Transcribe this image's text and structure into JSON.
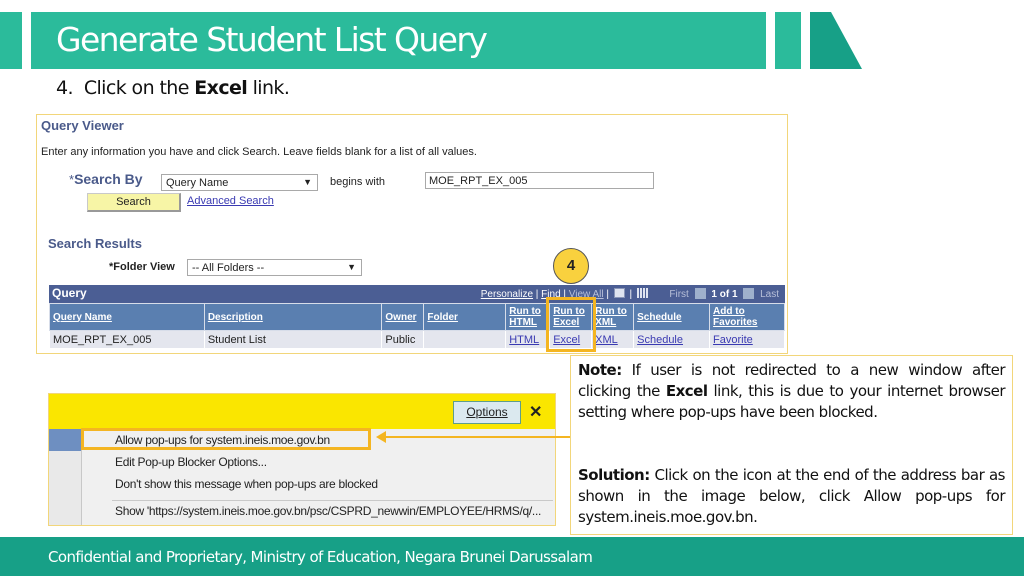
{
  "slide": {
    "title": "Generate Student List Query",
    "step_number": "4.",
    "step_prefix": "Click on the ",
    "step_bold": "Excel",
    "step_suffix": " link.",
    "badge": "4",
    "accent_color": "#2bbb9b",
    "highlight_color": "#f4b521"
  },
  "query_viewer": {
    "title": "Query Viewer",
    "instructions": "Enter any information you have and click Search. Leave fields blank for a list of all values.",
    "search_by_required": "*",
    "search_by_label": "Search By",
    "search_by_value": "Query Name",
    "begins_with_label": "begins with",
    "search_value": "MOE_RPT_EX_005",
    "search_button": "Search",
    "advanced_search": "Advanced Search",
    "results_title": "Search Results",
    "folder_view_label": "*Folder View",
    "folder_view_value": "-- All Folders --",
    "grid": {
      "title": "Query",
      "personalize": "Personalize",
      "find": "Find",
      "view_all": "View All",
      "first": "First",
      "page_info": "1 of 1",
      "last": "Last",
      "columns": [
        "Query Name",
        "Description",
        "Owner",
        "Folder",
        "Run to HTML",
        "Run to Excel",
        "Run to XML",
        "Schedule",
        "Add to Favorites"
      ],
      "rows": [
        {
          "query_name": "MOE_RPT_EX_005",
          "description": "Student List",
          "owner": "Public",
          "folder": "",
          "html": "HTML",
          "excel": "Excel",
          "xml": "XML",
          "schedule": "Schedule",
          "favorite": "Favorite"
        }
      ]
    }
  },
  "popup_blocker": {
    "options_button": "Options",
    "close": "✕",
    "menu": [
      "Allow pop-ups for system.ineis.moe.gov.bn",
      "Edit Pop-up Blocker Options...",
      "Don't show this message when pop-ups are blocked",
      "Show 'https://system.ineis.moe.gov.bn/psc/CSPRD_newwin/EMPLOYEE/HRMS/q/..."
    ]
  },
  "note": {
    "note_label": "Note:",
    "note_text_1": " If user is not redirected to a new window after clicking the ",
    "note_bold": "Excel",
    "note_text_2": " link, this is due to your internet browser setting where pop-ups have been blocked.",
    "solution_label": "Solution:",
    "solution_text": " Click on the icon at the end of the address bar as shown in the image below, click Allow pop-ups for system.ineis.moe.gov.bn."
  },
  "footer": {
    "text": "Confidential and Proprietary, Ministry of Education, Negara Brunei Darussalam"
  }
}
